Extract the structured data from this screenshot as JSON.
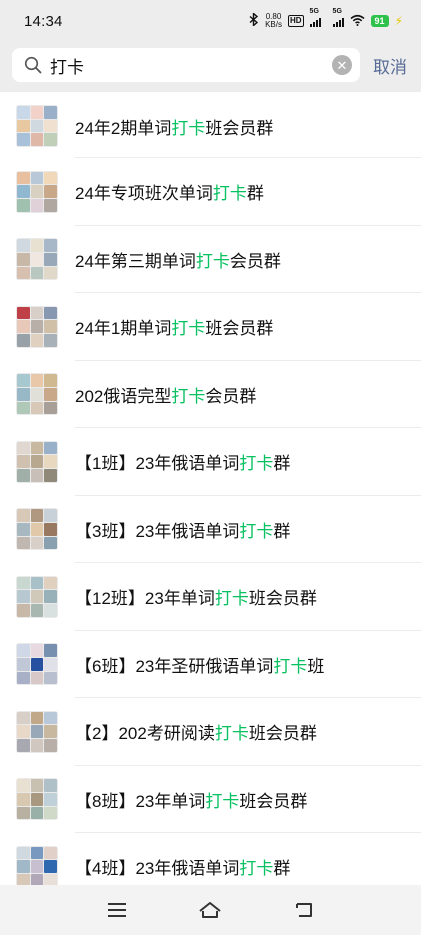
{
  "status_bar": {
    "time": "14:34",
    "net_speed_value": "0.80",
    "net_speed_unit": "KB/s",
    "hd_label": "HD",
    "sim1_label": "5G",
    "sim2_label": "5G",
    "battery": "91"
  },
  "search": {
    "query": "打卡",
    "cancel_label": "取消"
  },
  "results": [
    {
      "before": "24年2期单词",
      "match": "打卡",
      "after": "班会员群"
    },
    {
      "before": "24年专项班次单词",
      "match": "打卡",
      "after": "群"
    },
    {
      "before": "24年第三期单词",
      "match": "打卡",
      "after": "会员群"
    },
    {
      "before": "24年1期单词",
      "match": "打卡",
      "after": "班会员群"
    },
    {
      "before": "202俄语完型",
      "match": "打卡",
      "after": "会员群"
    },
    {
      "before": "【1班】23年俄语单词",
      "match": "打卡",
      "after": "群"
    },
    {
      "before": "【3班】23年俄语单词",
      "match": "打卡",
      "after": "群"
    },
    {
      "before": "【12班】23年单词",
      "match": "打卡",
      "after": "班会员群"
    },
    {
      "before": "【6班】23年圣研俄语单词",
      "match": "打卡",
      "after": "班"
    },
    {
      "before": "【2】202考研阅读",
      "match": "打卡",
      "after": "班会员群"
    },
    {
      "before": "【8班】23年单词",
      "match": "打卡",
      "after": "班会员群"
    },
    {
      "before": "【4班】23年俄语单词",
      "match": "打卡",
      "after": "群"
    }
  ],
  "colors": {
    "highlight": "#07c160",
    "cancel": "#576b95",
    "battery": "#2fc24a"
  },
  "icons": {
    "search": "search-icon",
    "clear": "clear-icon",
    "menu": "menu-icon",
    "home": "home-icon",
    "back": "back-icon"
  }
}
